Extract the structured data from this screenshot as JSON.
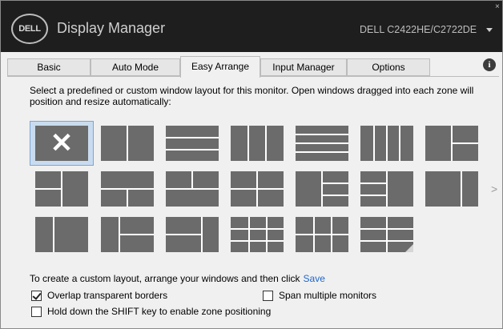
{
  "app": {
    "logo_text": "DELL",
    "title": "Display Manager",
    "monitor_name": "DELL C2422HE/C2722DE",
    "close_icon": "close-icon",
    "dropdown_icon": "chevron-down-icon"
  },
  "tabs": [
    {
      "label": "Basic",
      "active": false
    },
    {
      "label": "Auto Mode",
      "active": false
    },
    {
      "label": "Easy Arrange",
      "active": true
    },
    {
      "label": "Input Manager",
      "active": false
    },
    {
      "label": "Options",
      "active": false
    }
  ],
  "info_icon": {
    "glyph": "i",
    "name": "info-icon"
  },
  "easy_arrange": {
    "description": "Select a predefined or custom window layout for this monitor.  Open windows dragged into each zone will position and resize automatically:",
    "selected_layout": 1,
    "layout_count": 19,
    "next_arrow": ">",
    "custom_prefix": "To create a custom layout, arrange your windows and then click",
    "save_link": "Save",
    "checkboxes": {
      "overlap": {
        "label": "Overlap transparent borders",
        "checked": true
      },
      "span": {
        "label": "Span multiple monitors",
        "checked": false
      },
      "shift": {
        "label": "Hold down the SHIFT key to enable zone positioning",
        "checked": false
      }
    }
  },
  "colors": {
    "titlebar": "#1e1e1e",
    "thumb": "#6b6b6b",
    "selection": "#c9dcef",
    "link": "#1f66c9"
  }
}
